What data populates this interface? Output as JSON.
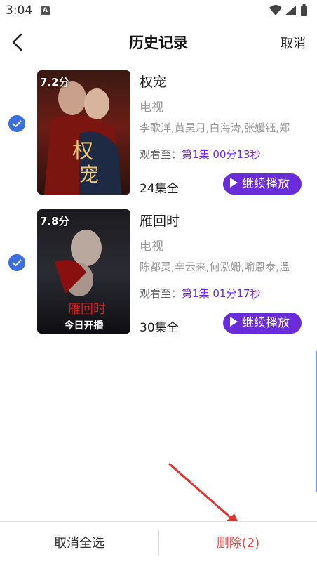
{
  "status_bar": {
    "time": "3:04",
    "notification": "A"
  },
  "header": {
    "title": "历史记录",
    "cancel_label": "取消"
  },
  "items": [
    {
      "rating": "7.2分",
      "title": "权宠",
      "genre": "电视",
      "cast": "李歌洋,黄昊月,白海涛,张媛钰,郑",
      "progress_label": "观看至：",
      "progress_value": "第1集 00分13秒",
      "episodes": "24集全",
      "play_label": "继续播放",
      "checked": true,
      "poster_text": "权宠"
    },
    {
      "rating": "7.8分",
      "title": "雁回时",
      "genre": "电视",
      "cast": "陈都灵,辛云来,何泓姗,喻恩泰,温",
      "progress_label": "观看至：",
      "progress_value": "第1集 01分17秒",
      "episodes": "30集全",
      "play_label": "继续播放",
      "checked": true,
      "poster_text": "雁回时",
      "poster_caption": "今日开播"
    }
  ],
  "bottom_bar": {
    "deselect_label": "取消全选",
    "delete_label": "删除(2)"
  },
  "colors": {
    "accent": "#6a2bd8",
    "checkbox": "#3b6fe0",
    "delete": "#ef4b4b",
    "arrow": "#e53030"
  }
}
